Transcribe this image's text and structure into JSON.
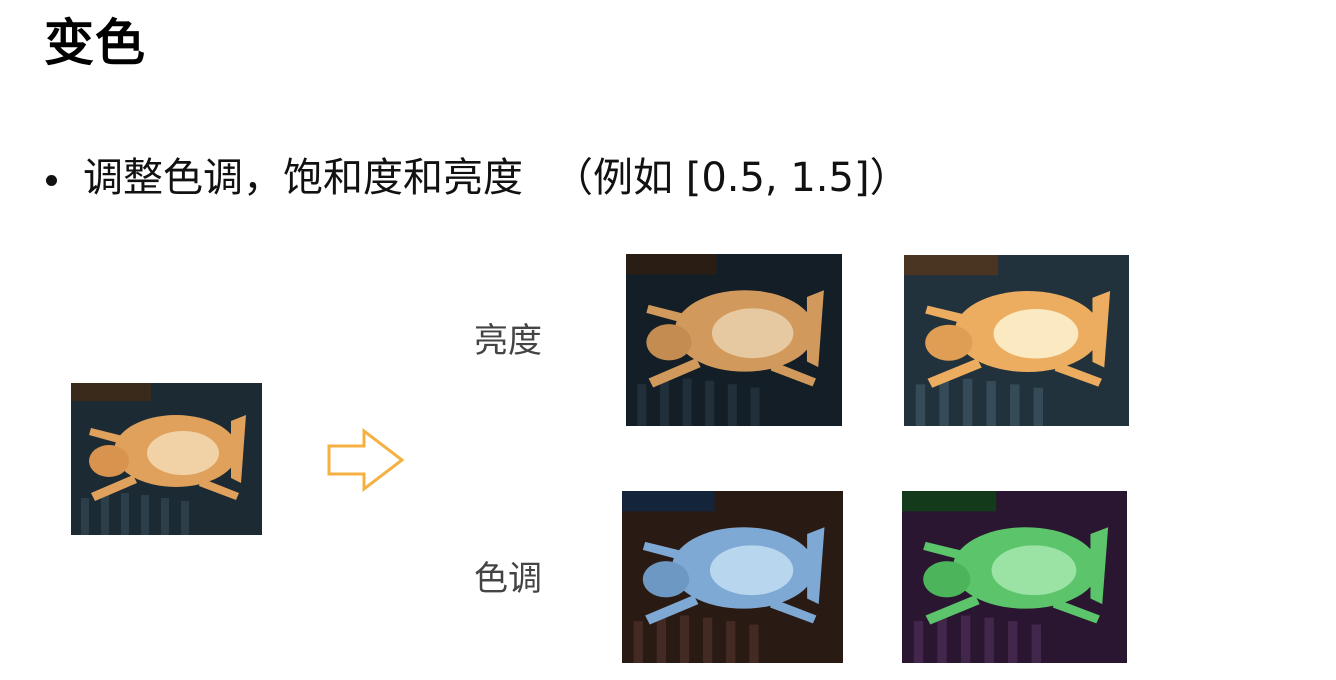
{
  "slide": {
    "title": "变色",
    "bullet": "调整色调，饱和度和亮度",
    "example": "（例如 [0.5, 1.5]）"
  },
  "rows": {
    "brightness_label": "亮度",
    "hue_label": "色调"
  },
  "images": [
    {
      "id": "original",
      "desc_name": "original-cat-photo"
    },
    {
      "id": "brightness-low",
      "desc_name": "brightness-darker-cat-photo"
    },
    {
      "id": "brightness-high",
      "desc_name": "brightness-brighter-cat-photo"
    },
    {
      "id": "hue-blue",
      "desc_name": "hue-blue-cat-photo"
    },
    {
      "id": "hue-green",
      "desc_name": "hue-green-cat-photo"
    }
  ],
  "colors": {
    "arrow": "#f4b142",
    "original": {
      "bg": "#1c2a33",
      "cat": "#e0a15c",
      "belly": "#f1d2a6"
    },
    "brightness_low": {
      "bg": "#141e26",
      "cat": "#d19a5c",
      "belly": "#e6c9a0"
    },
    "brightness_high": {
      "bg": "#22323c",
      "cat": "#ecad60",
      "belly": "#fbe9c2"
    },
    "hue_blue": {
      "bg": "#2a1a14",
      "cat": "#7ea9d4",
      "belly": "#b9d6ef"
    },
    "hue_green": {
      "bg": "#2a1630",
      "cat": "#5cc46a",
      "belly": "#9be3a4"
    }
  }
}
